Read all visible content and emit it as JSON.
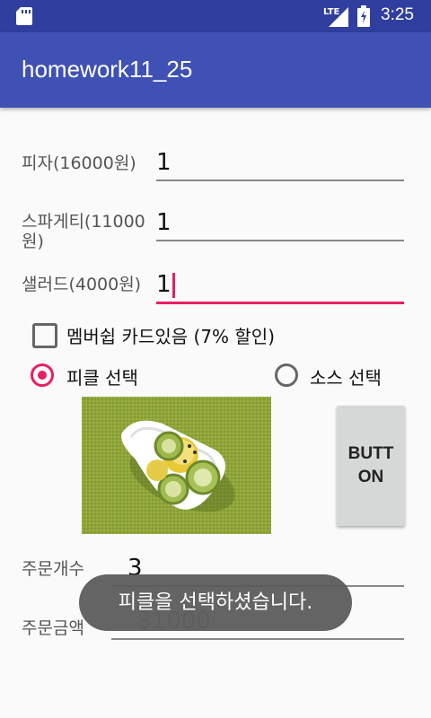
{
  "status_bar": {
    "network": "LTE",
    "time": "3:25"
  },
  "app_bar": {
    "title": "homework11_25"
  },
  "items": [
    {
      "label": "피자(16000원)",
      "quantity": "1"
    },
    {
      "label": "스파게티(11000원)",
      "quantity": "1"
    },
    {
      "label": "샐러드(4000원)",
      "quantity": "1"
    }
  ],
  "membership": {
    "label": "멤버쉽 카드있음 (7% 할인)",
    "checked": false
  },
  "radio_options": [
    {
      "label": "피클 선택",
      "selected": true
    },
    {
      "label": "소스 선택",
      "selected": false
    }
  ],
  "button": {
    "label": "BUTTON"
  },
  "summary": {
    "count_label": "주문개수",
    "count_value": "3",
    "total_label": "주문금액",
    "total_value": "31000"
  },
  "toast": {
    "message": "피클을 선택하셨습니다."
  },
  "colors": {
    "primary": "#3F51B5",
    "primary_dark": "#303F9F",
    "accent": "#E91E63"
  }
}
